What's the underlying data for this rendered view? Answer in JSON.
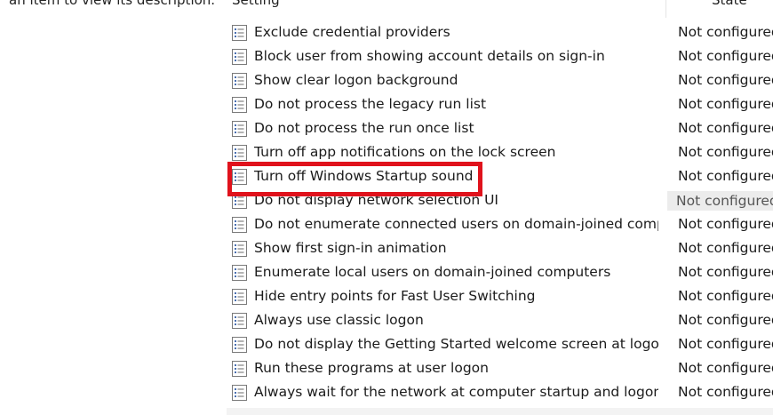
{
  "left_pane": {
    "description_text": "an item to view its description."
  },
  "table": {
    "columns": {
      "setting": "Setting",
      "state": "State"
    },
    "rows": [
      {
        "name": "Exclude credential providers",
        "state": "Not configured"
      },
      {
        "name": "Block user from showing account details on sign-in",
        "state": "Not configured"
      },
      {
        "name": "Show clear logon background",
        "state": "Not configured"
      },
      {
        "name": "Do not process the legacy run list",
        "state": "Not configured"
      },
      {
        "name": "Do not process the run once list",
        "state": "Not configured"
      },
      {
        "name": "Turn off app notifications on the lock screen",
        "state": "Not configured"
      },
      {
        "name": "Turn off Windows Startup sound",
        "state": "Not configured"
      },
      {
        "name": "Do not display network selection UI",
        "state": "Not configured"
      },
      {
        "name": "Do not enumerate connected users on domain-joined comp...",
        "state": "Not configured"
      },
      {
        "name": "Show first sign-in animation",
        "state": "Not configured"
      },
      {
        "name": "Enumerate local users on domain-joined computers",
        "state": "Not configured"
      },
      {
        "name": "Hide entry points for Fast User Switching",
        "state": "Not configured"
      },
      {
        "name": "Always use classic logon",
        "state": "Not configured"
      },
      {
        "name": "Do not display the Getting Started welcome screen at logon",
        "state": "Not configured"
      },
      {
        "name": "Run these programs at user logon",
        "state": "Not configured"
      },
      {
        "name": "Always wait for the network at computer startup and logon",
        "state": "Not configured"
      }
    ]
  },
  "annotation": {
    "color": "#e0121c"
  },
  "icons": {
    "row_icon": "policy-setting-icon"
  }
}
